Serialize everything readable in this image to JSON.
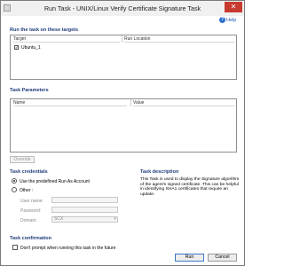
{
  "window": {
    "title": "Run Task - UNIX/Linux Verify Certificate Signature Task",
    "close_glyph": "✕"
  },
  "help": {
    "label": "Help",
    "icon": "help-icon"
  },
  "targets": {
    "section_title": "Run the task on these targets",
    "columns": [
      "Target",
      "Run Location"
    ],
    "rows": [
      {
        "checked": true,
        "target": "Ubuntu_1",
        "run_location": ""
      }
    ]
  },
  "parameters": {
    "section_title": "Task Parameters",
    "columns": [
      "Name",
      "Value"
    ],
    "override_label": "Override"
  },
  "credentials": {
    "section_title": "Task credentials",
    "use_predefined_label": "Use the predefined Run As Account",
    "other_label": "Other :",
    "selected": "use_predefined",
    "username_label": "User name:",
    "password_label": "Password:",
    "domain_label": "Domain:",
    "domain_value": "SCX"
  },
  "description": {
    "section_title": "Task description",
    "text": "This Task is used to display the Signature algorithm of the agent's signed certificate. This can be helpful in identifying SHA1 certificates that require an update."
  },
  "confirmation": {
    "section_title": "Task confirmation",
    "dont_prompt_label": "Don't prompt when running this task in the future",
    "checked": false
  },
  "buttons": {
    "run": "Run",
    "cancel": "Cancel"
  }
}
